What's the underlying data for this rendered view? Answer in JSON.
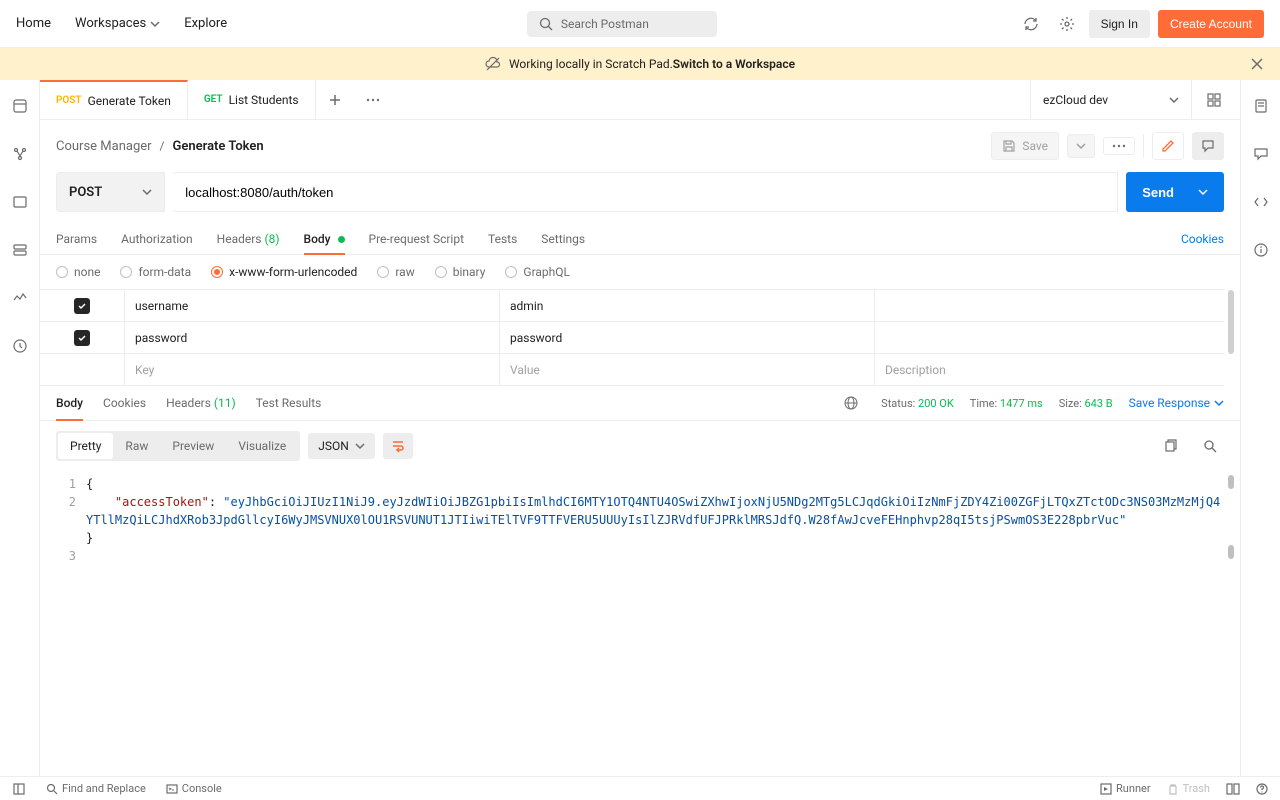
{
  "topbar": {
    "home": "Home",
    "workspaces": "Workspaces",
    "explore": "Explore",
    "search_placeholder": "Search Postman",
    "signin": "Sign In",
    "create": "Create Account"
  },
  "banner": {
    "text": "Working locally in Scratch Pad. ",
    "link": "Switch to a Workspace"
  },
  "tabs": [
    {
      "method": "POST",
      "method_class": "post",
      "label": "Generate Token",
      "active": true
    },
    {
      "method": "GET",
      "method_class": "get",
      "label": "List Students",
      "active": false
    }
  ],
  "env_name": "ezCloud dev",
  "breadcrumb": {
    "collection": "Course Manager",
    "request": "Generate Token",
    "save": "Save"
  },
  "request": {
    "method": "POST",
    "url": "localhost:8080/auth/token",
    "send": "Send"
  },
  "request_tabs": {
    "params": "Params",
    "auth": "Authorization",
    "headers": "Headers",
    "headers_count": "(8)",
    "body": "Body",
    "prerequest": "Pre-request Script",
    "tests": "Tests",
    "settings": "Settings",
    "cookies": "Cookies"
  },
  "body_types": {
    "none": "none",
    "formdata": "form-data",
    "urlencoded": "x-www-form-urlencoded",
    "raw": "raw",
    "binary": "binary",
    "graphql": "GraphQL"
  },
  "kv": {
    "rows": [
      {
        "key": "username",
        "value": "admin"
      },
      {
        "key": "password",
        "value": "password"
      }
    ],
    "key_ph": "Key",
    "val_ph": "Value",
    "desc_ph": "Description"
  },
  "response_tabs": {
    "body": "Body",
    "cookies": "Cookies",
    "headers": "Headers",
    "headers_count": "(11)",
    "test_results": "Test Results"
  },
  "response_meta": {
    "status_label": "Status:",
    "status": "200 OK",
    "time_label": "Time:",
    "time": "1477 ms",
    "size_label": "Size:",
    "size": "643 B",
    "save": "Save Response"
  },
  "viewer": {
    "pretty": "Pretty",
    "raw": "Raw",
    "preview": "Preview",
    "visualize": "Visualize",
    "lang": "JSON"
  },
  "response_body": {
    "line1_num": "1",
    "line2_num": "2",
    "line3_num": "3",
    "open_brace": "{",
    "key": "\"accessToken\"",
    "colon": ": ",
    "value": "\"eyJhbGciOiJIUzI1NiJ9.eyJzdWIiOiJBZG1pbiIsImlhdCI6MTY1OTQ4NTU4OSwiZXhwIjoxNjU5NDg2MTg5LCJqdGkiOiIzNmFjZDY4Zi00ZGFjLTQxZTctODc3NS03MzMzMjQ4YTllMzQiLCJhdXRob3JpdGllcyI6WyJMSVNUX0lOU1RSVUNUT1JTIiwiTElTVF9TTFVERU5UUUyIsIlZJRVdfUFJPRklMRSJdfQ.W28fAwJcveFEHnphvp28qI5tsjPSwmOS3E228pbrVuc\"",
    "close_brace": "}"
  },
  "statusbar": {
    "find": "Find and Replace",
    "console": "Console",
    "runner": "Runner",
    "trash": "Trash"
  }
}
